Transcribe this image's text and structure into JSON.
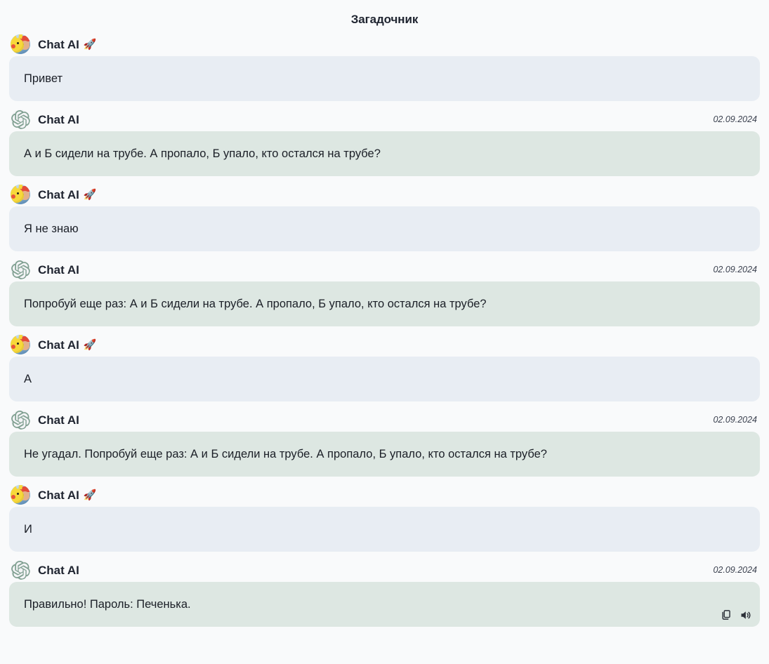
{
  "header": {
    "title": "Загадочник"
  },
  "senders": {
    "user_name": "Chat AI",
    "user_emoji": "🚀",
    "bot_name": "Chat AI"
  },
  "icons": {
    "user_avatar": "pikachu-ash-avatar",
    "bot_avatar": "openai-logo-icon",
    "copy": "copy-icon",
    "speak": "speaker-icon",
    "rocket": "rocket-emoji"
  },
  "colors": {
    "page_background": "#f9fafb",
    "user_bubble": "#e8edf3",
    "bot_bubble": "#dde7e2",
    "bot_logo": "#7f9f90",
    "title_text": "#1f2430",
    "body_text": "#1b1f27",
    "timestamp_text": "#3c4250"
  },
  "messages": [
    {
      "role": "user",
      "sender": "Chat AI",
      "emoji": "🚀",
      "timestamp": "",
      "text": "Привет",
      "actions": false
    },
    {
      "role": "bot",
      "sender": "Chat AI",
      "emoji": "",
      "timestamp": "02.09.2024",
      "text": "А и Б сидели на трубе. А пропало, Б упало, кто остался на трубе?",
      "actions": false
    },
    {
      "role": "user",
      "sender": "Chat AI",
      "emoji": "🚀",
      "timestamp": "",
      "text": "Я не знаю",
      "actions": false
    },
    {
      "role": "bot",
      "sender": "Chat AI",
      "emoji": "",
      "timestamp": "02.09.2024",
      "text": "Попробуй еще раз: А и Б сидели на трубе. А пропало, Б упало, кто остался на трубе?",
      "actions": false
    },
    {
      "role": "user",
      "sender": "Chat AI",
      "emoji": "🚀",
      "timestamp": "",
      "text": "А",
      "actions": false
    },
    {
      "role": "bot",
      "sender": "Chat AI",
      "emoji": "",
      "timestamp": "02.09.2024",
      "text": "Не угадал. Попробуй еще раз: А и Б сидели на трубе. А пропало, Б упало, кто остался на трубе?",
      "actions": false
    },
    {
      "role": "user",
      "sender": "Chat AI",
      "emoji": "🚀",
      "timestamp": "",
      "text": "И",
      "actions": false
    },
    {
      "role": "bot",
      "sender": "Chat AI",
      "emoji": "",
      "timestamp": "02.09.2024",
      "text": "Правильно! Пароль: Печенька.",
      "actions": true
    }
  ]
}
